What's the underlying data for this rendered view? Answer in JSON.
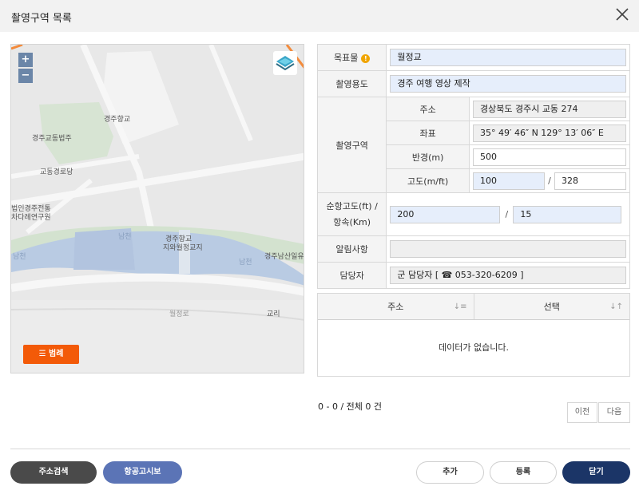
{
  "dialog": {
    "title": "촬영구역 목록"
  },
  "map": {
    "zoom_in": "+",
    "zoom_out": "−",
    "legend_label": "범례",
    "labels": [
      "경주향교",
      "경주교동법주",
      "교동경로당",
      "법인경주전통",
      "차다례연구원",
      "경주향교",
      "지와월정교지",
      "경주남산일유",
      "월정로",
      "교리",
      "남천",
      "남천",
      "남천"
    ]
  },
  "form": {
    "target": {
      "label": "목표물",
      "value": "월정교"
    },
    "purpose": {
      "label": "촬영용도",
      "value": "경주 여행 영상 제작"
    },
    "area": {
      "label": "촬영구역",
      "address_label": "주소",
      "address": "경상북도 경주시 교동 274",
      "coord_label": "좌표",
      "coord": "35° 49′ 46″ N 129° 13′ 06″ E",
      "radius_label": "반경(m)",
      "radius": "500",
      "alt_label": "고도(m/ft)",
      "alt_m": "100",
      "alt_ft": "328"
    },
    "cruise": {
      "label_line1": "순항고도(ft) /",
      "label_line2": "항속(Km)",
      "alt": "200",
      "speed": "15"
    },
    "notice": {
      "label": "알림사항",
      "value": ""
    },
    "manager": {
      "label": "담당자",
      "value": "군 담당자 [ ☎ 053-320-6209 ]"
    }
  },
  "grid": {
    "columns": [
      "주소",
      "선택"
    ],
    "empty_text": "데이터가 없습니다."
  },
  "pagination": {
    "info": "0 - 0 / 전체 0 건",
    "prev": "이전",
    "next": "다음"
  },
  "buttons": {
    "address_search": "주소검색",
    "aviation_notice": "항공고시보",
    "add": "추가",
    "register": "등록",
    "close": "닫기"
  },
  "colors": {
    "accent_orange": "#f35a08",
    "navy": "#1b3567",
    "purple": "#5b74b6",
    "input_blue": "#e6eefb"
  }
}
